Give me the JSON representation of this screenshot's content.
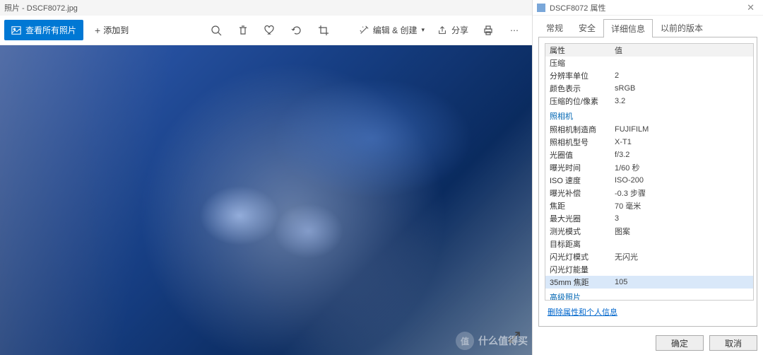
{
  "photos": {
    "title": "照片 - DSCF8072.jpg",
    "collection_button": "查看所有照片",
    "add_button": "添加到",
    "edit_create": "编辑 & 创建",
    "share": "分享"
  },
  "props": {
    "title": "DSCF8072 属性",
    "tabs": {
      "general": "常规",
      "security": "安全",
      "details": "详细信息",
      "previous": "以前的版本"
    },
    "header": {
      "key": "属性",
      "val": "值"
    },
    "rows": [
      {
        "k": "压缩",
        "v": ""
      },
      {
        "k": "分辨率单位",
        "v": "2"
      },
      {
        "k": "颜色表示",
        "v": "sRGB"
      },
      {
        "k": "压缩的位/像素",
        "v": "3.2"
      }
    ],
    "section_camera": "照相机",
    "camera_rows": [
      {
        "k": "照相机制造商",
        "v": "FUJIFILM"
      },
      {
        "k": "照相机型号",
        "v": "X-T1"
      },
      {
        "k": "光圈值",
        "v": "f/3.2"
      },
      {
        "k": "曝光时间",
        "v": "1/60 秒"
      },
      {
        "k": "ISO 速度",
        "v": "ISO-200"
      },
      {
        "k": "曝光补偿",
        "v": "-0.3 步骤"
      },
      {
        "k": "焦距",
        "v": "70 毫米"
      },
      {
        "k": "最大光圈",
        "v": "3"
      },
      {
        "k": "测光模式",
        "v": "图案"
      },
      {
        "k": "目标距离",
        "v": ""
      },
      {
        "k": "闪光灯模式",
        "v": "无闪光"
      },
      {
        "k": "闪光灯能量",
        "v": ""
      },
      {
        "k": "35mm 焦距",
        "v": "105"
      }
    ],
    "section_advanced": "高级照片",
    "remove_link": "删除属性和个人信息",
    "ok": "确定",
    "cancel": "取消"
  },
  "watermark": {
    "circle": "值",
    "text": "什么值得买"
  }
}
